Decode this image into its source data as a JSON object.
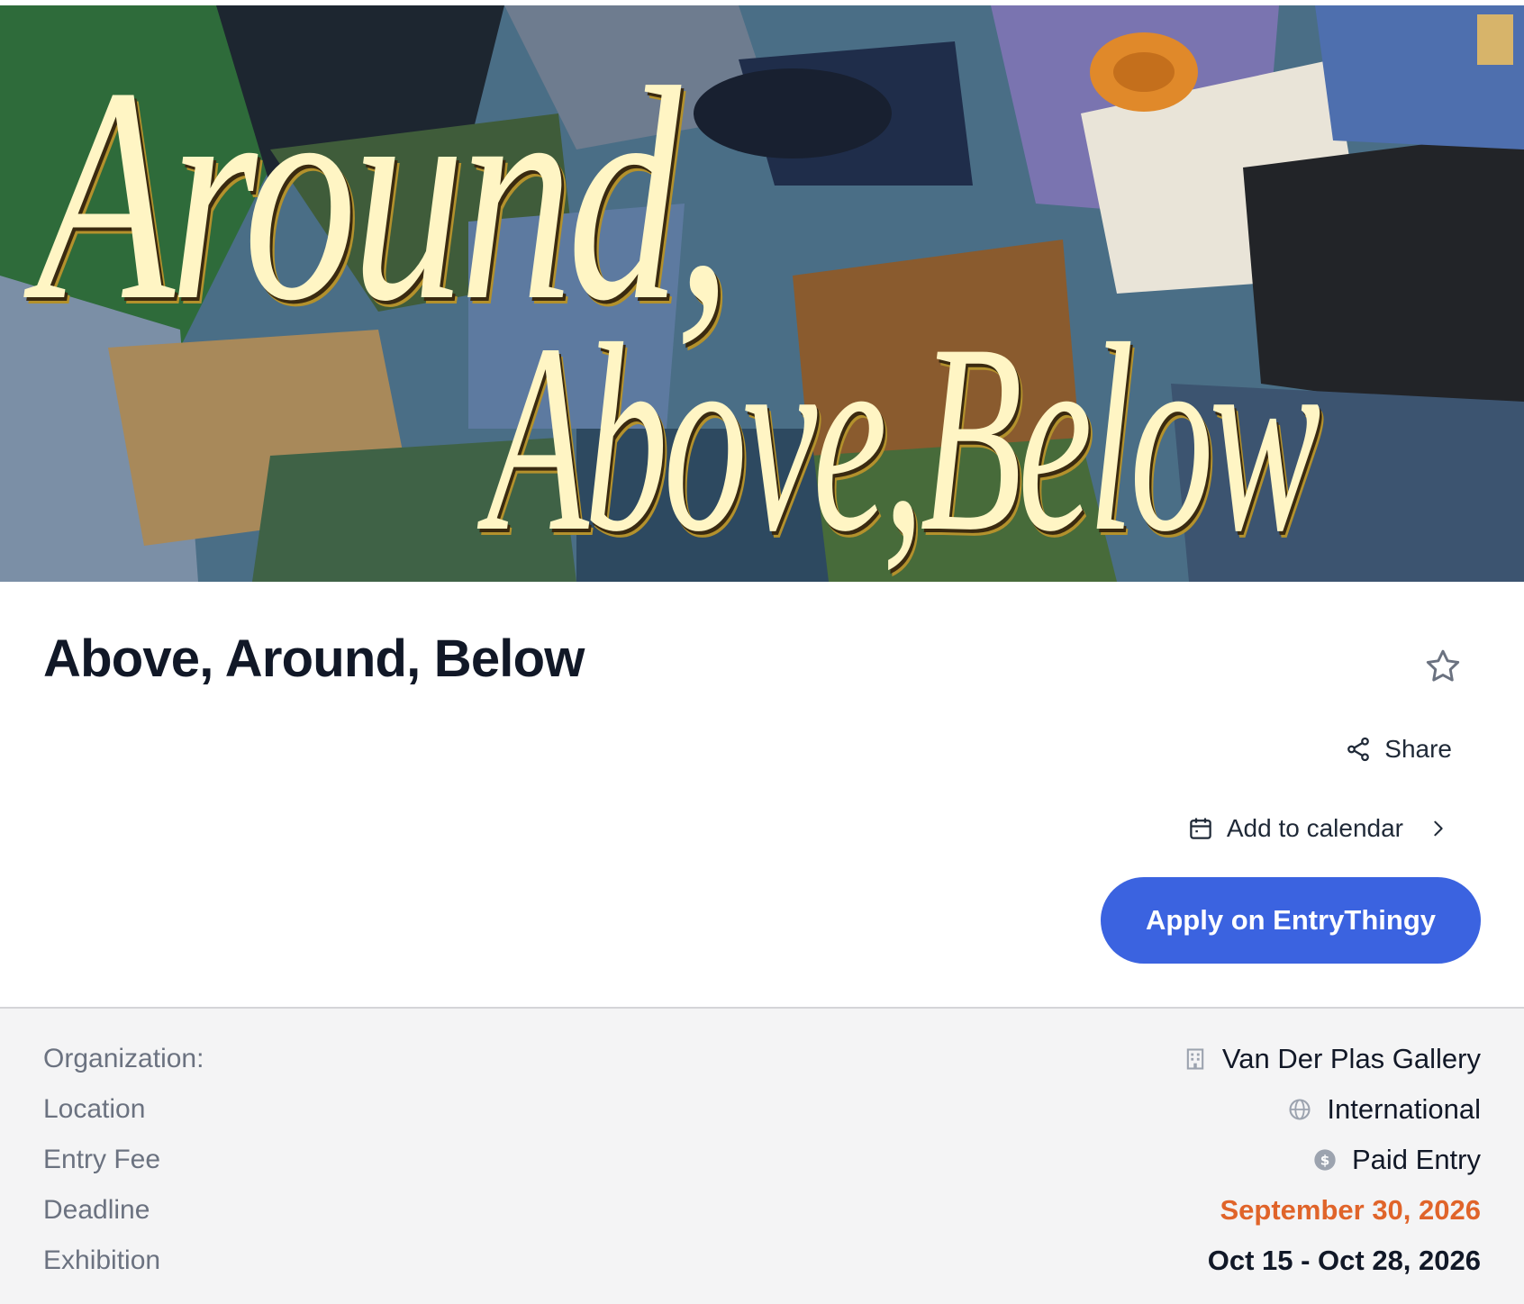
{
  "hero": {
    "artwork_line1": "Around,",
    "artwork_line2": "Above,Below"
  },
  "title": "Above, Around, Below",
  "actions": {
    "favorite_icon": "star-icon",
    "share_label": "Share",
    "share_icon": "share-icon",
    "calendar_label": "Add to calendar",
    "calendar_icon": "calendar-icon",
    "calendar_chevron_icon": "chevron-right-icon",
    "apply_label": "Apply on EntryThingy"
  },
  "details": {
    "organization": {
      "label": "Organization:",
      "value": "Van Der Plas Gallery",
      "icon": "building-icon"
    },
    "location": {
      "label": "Location",
      "value": "International",
      "icon": "globe-icon"
    },
    "entry_fee": {
      "label": "Entry Fee",
      "value": "Paid Entry",
      "icon": "dollar-circle-icon"
    },
    "deadline": {
      "label": "Deadline",
      "value": "September 30, 2026"
    },
    "exhibition": {
      "label": "Exhibition",
      "value": "Oct 15 - Oct 28, 2026"
    }
  },
  "colors": {
    "accent": "#3b63e0",
    "deadline": "#e0642a",
    "panel_bg": "#f4f4f5",
    "title_text": "#111827"
  }
}
